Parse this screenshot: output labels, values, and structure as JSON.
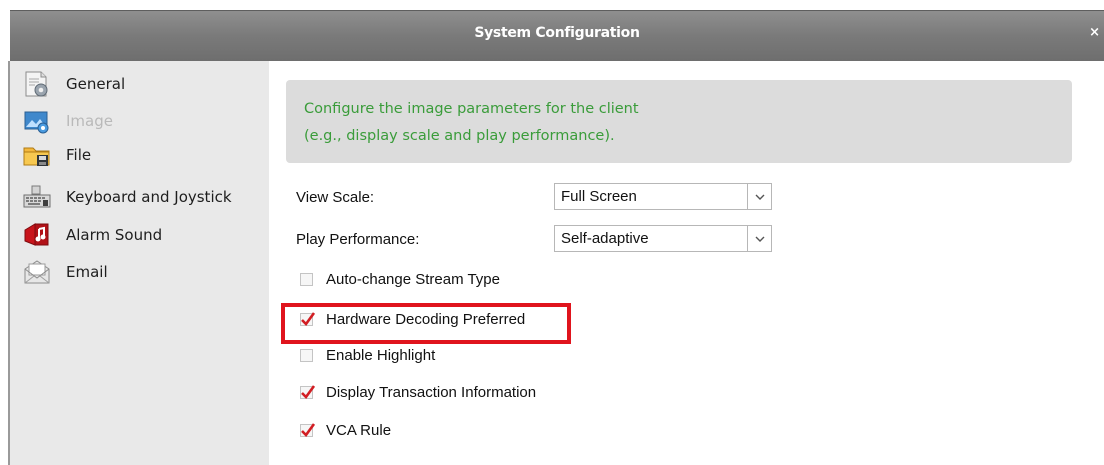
{
  "window": {
    "title": "System Configuration",
    "close_label": "×"
  },
  "sidebar": {
    "items": [
      {
        "label": "General",
        "icon": "general-settings-icon",
        "selected": false
      },
      {
        "label": "Image",
        "icon": "image-icon",
        "selected": true
      },
      {
        "label": "File",
        "icon": "folder-icon",
        "selected": false
      },
      {
        "label": "Keyboard and Joystick",
        "icon": "keyboard-icon",
        "selected": false
      },
      {
        "label": "Alarm Sound",
        "icon": "alarm-sound-icon",
        "selected": false
      },
      {
        "label": "Email",
        "icon": "email-icon",
        "selected": false
      }
    ]
  },
  "main": {
    "info": {
      "line1": "Configure the image parameters for the client",
      "line2": "(e.g., display scale and play performance)."
    },
    "view_scale": {
      "label": "View Scale:",
      "value": "Full Screen"
    },
    "play_performance": {
      "label": "Play Performance:",
      "value": "Self-adaptive"
    },
    "checkboxes": [
      {
        "label": "Auto-change Stream Type",
        "checked": false
      },
      {
        "label": "Hardware Decoding Preferred",
        "checked": true
      },
      {
        "label": "Enable Highlight",
        "checked": false
      },
      {
        "label": "Display Transaction Information",
        "checked": true
      },
      {
        "label": "VCA Rule",
        "checked": true
      }
    ]
  },
  "colors": {
    "accent_green": "#3a9c3a",
    "check_red": "#d21e23",
    "highlight_red": "#e0141d",
    "titlebar_gray": "#7a7a7a"
  }
}
